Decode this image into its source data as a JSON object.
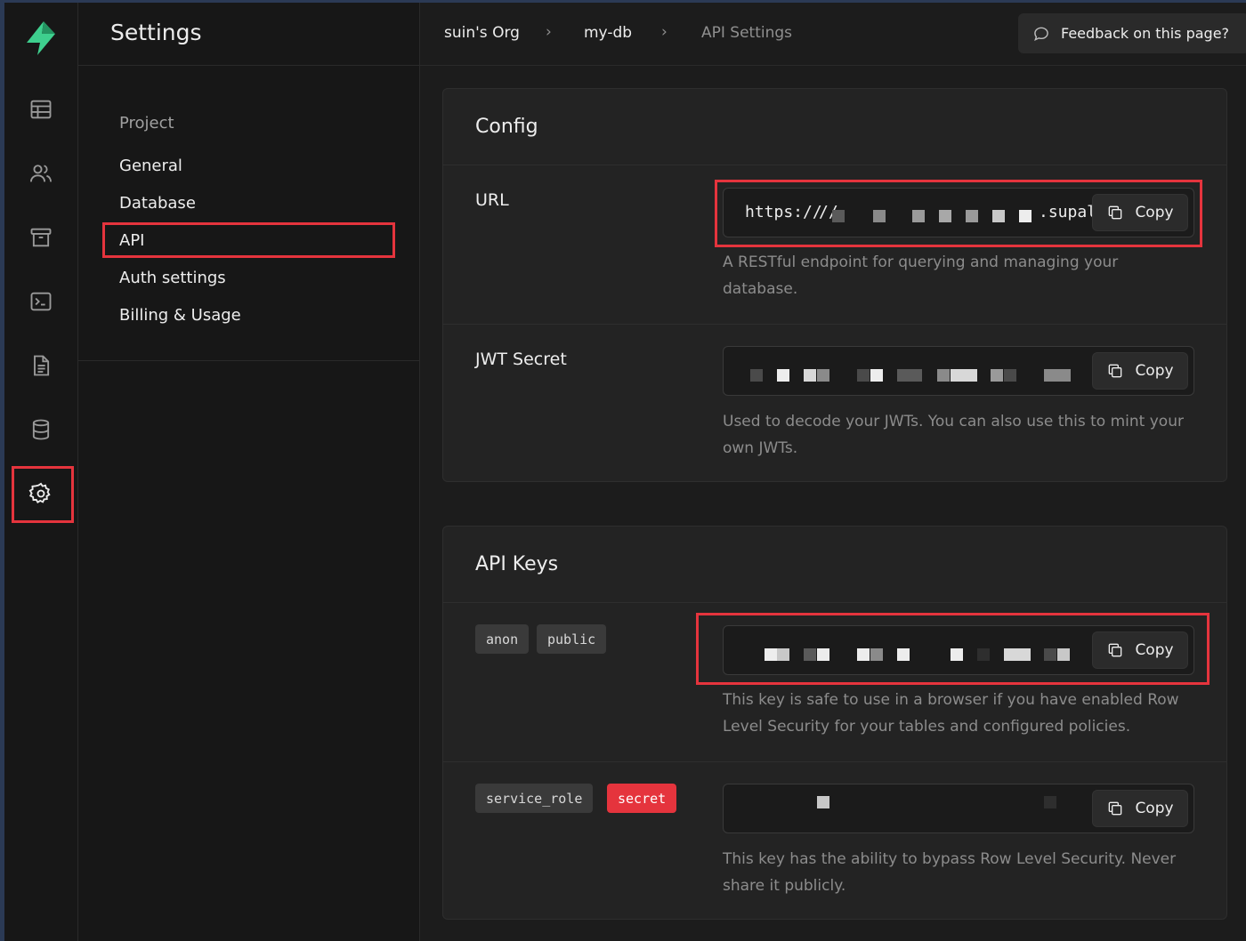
{
  "sidebar": {
    "icons": [
      "bolt-logo",
      "table-icon",
      "users-icon",
      "archive-icon",
      "terminal-icon",
      "file-icon",
      "database-icon",
      "settings-icon"
    ],
    "active": "settings-icon"
  },
  "settings_menu": {
    "title": "Settings",
    "group": "Project",
    "items": [
      "General",
      "Database",
      "API",
      "Auth settings",
      "Billing & Usage"
    ],
    "active_item": "API"
  },
  "breadcrumb": {
    "org": "suin's Org",
    "project": "my-db",
    "page": "API Settings"
  },
  "feedback": {
    "label": "Feedback on this page?"
  },
  "config": {
    "title": "Config",
    "url": {
      "label": "URL",
      "value_prefix": "https://",
      "value_suffix": ".supal",
      "help": "A RESTful endpoint for querying and managing your database.",
      "copy_label": "Copy"
    },
    "jwt": {
      "label": "JWT Secret",
      "help": "Used to decode your JWTs. You can also use this to mint your own JWTs.",
      "copy_label": "Copy"
    }
  },
  "api_keys": {
    "title": "API Keys",
    "anon": {
      "badges": [
        "anon",
        "public"
      ],
      "help": "This key is safe to use in a browser if you have enabled Row Level Security for your tables and configured policies.",
      "copy_label": "Copy"
    },
    "service_role": {
      "badges": [
        "service_role",
        "secret"
      ],
      "help": "This key has the ability to bypass Row Level Security. Never share it publicly.",
      "copy_label": "Copy"
    }
  },
  "colors": {
    "highlight": "#e5343d",
    "brand": "#3ecf8e"
  }
}
